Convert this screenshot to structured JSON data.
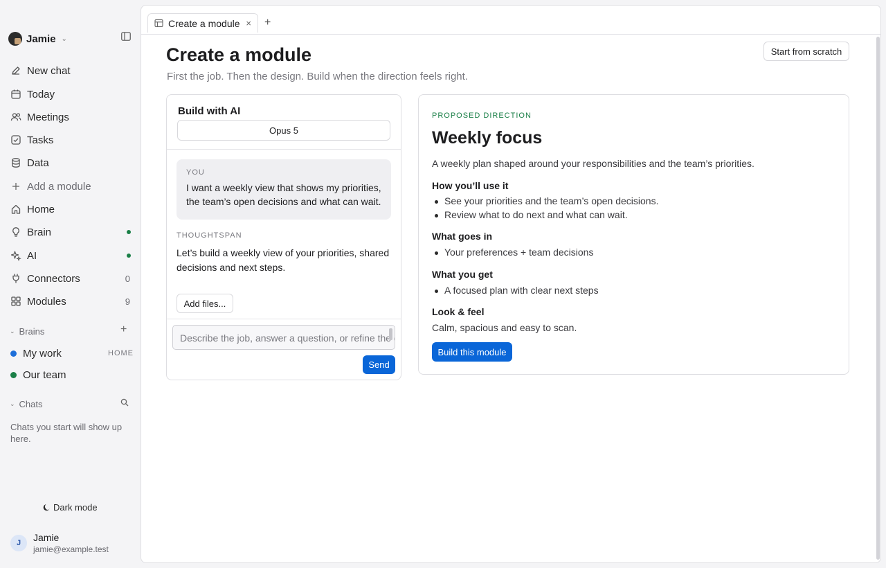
{
  "sidebar": {
    "workspace_name": "Jamie",
    "nav": [
      {
        "label": "New chat",
        "icon": "pencil-icon"
      },
      {
        "label": "Today",
        "icon": "calendar-icon"
      },
      {
        "label": "Meetings",
        "icon": "people-icon"
      },
      {
        "label": "Tasks",
        "icon": "checkbox-icon"
      },
      {
        "label": "Data",
        "icon": "database-icon"
      },
      {
        "label": "Add a module",
        "icon": "plus-icon"
      },
      {
        "label": "Home",
        "icon": "home-icon"
      },
      {
        "label": "Brain",
        "icon": "lightbulb-icon",
        "status": "online"
      },
      {
        "label": "AI",
        "icon": "sparkle-icon",
        "status": "online"
      },
      {
        "label": "Connectors",
        "icon": "plug-icon",
        "count": "0"
      },
      {
        "label": "Modules",
        "icon": "grid-icon",
        "count": "9"
      }
    ],
    "brains_header": "Brains",
    "brains": [
      {
        "label": "My work",
        "tag": "HOME",
        "color": "#1e6fd9"
      },
      {
        "label": "Our team",
        "color": "#1a7f47"
      }
    ],
    "chats_header": "Chats",
    "chats_empty": "Chats you start will show up here.",
    "dark_mode_label": "Dark mode",
    "user": {
      "initial": "J",
      "name": "Jamie",
      "email": "jamie@example.test"
    }
  },
  "tabs": [
    {
      "label": "Create a module",
      "active": true
    }
  ],
  "page": {
    "title": "Create a module",
    "subtitle": "First the job. Then the design. Build when the direction feels right.",
    "start_scratch_label": "Start from scratch"
  },
  "ai_panel": {
    "title": "Build with AI",
    "model": "Opus 5",
    "user_label": "YOU",
    "user_message": "I want a weekly view that shows my priorities, the team’s open decisions and what can wait.",
    "assistant_label": "THOUGHTSPAN",
    "assistant_message": "Let’s build a weekly view of your priorities, shared decisions and next steps.",
    "add_files_label": "Add files...",
    "composer_placeholder": "Describe the job, answer a question, or refine the direction",
    "send_label": "Send"
  },
  "direction": {
    "kicker": "PROPOSED DIRECTION",
    "title": "Weekly focus",
    "description": "A weekly plan shaped around your responsibilities and the team’s priorities.",
    "use_heading": "How you’ll use it",
    "use_items": [
      "See your priorities and the team’s open decisions.",
      "Review what to do next and what can wait."
    ],
    "inputs_heading": "What goes in",
    "inputs_items": [
      "Your preferences + team decisions"
    ],
    "outputs_heading": "What you get",
    "outputs_items": [
      "A focused plan with clear next steps"
    ],
    "look_heading": "Look & feel",
    "look_text": "Calm, spacious and easy to scan.",
    "build_label": "Build this module"
  },
  "colors": {
    "accent": "#0a66d8",
    "online": "#1a7f47",
    "kicker": "#1a7f47"
  }
}
